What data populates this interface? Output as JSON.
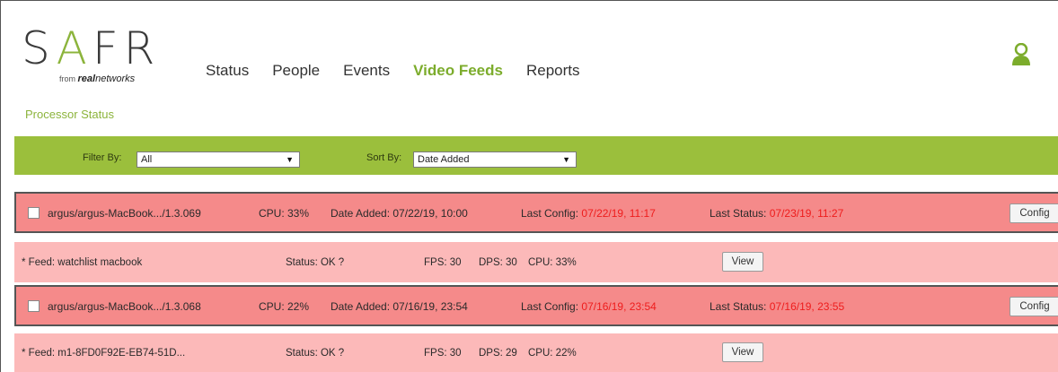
{
  "logo": {
    "part1": "S",
    "part2": "A",
    "part3": "FR",
    "from": "from",
    "brand_bold": "real",
    "brand_rest": "networks"
  },
  "nav": {
    "status": "Status",
    "people": "People",
    "events": "Events",
    "video_feeds": "Video Feeds",
    "reports": "Reports"
  },
  "subtitle": "Processor Status",
  "filter": {
    "filter_label": "Filter By:",
    "filter_value": "All",
    "sort_label": "Sort By:",
    "sort_value": "Date Added",
    "arrow": "▼"
  },
  "processors": [
    {
      "name": "argus/argus-MacBook.../1.3.069",
      "cpu": "CPU:  33%",
      "date_added": "Date Added: 07/22/19, 10:00",
      "last_config_label": "Last Config:",
      "last_config": "07/22/19, 11:17",
      "last_status_label": "Last Status:",
      "last_status": "07/23/19, 11:27",
      "config_btn": "Config",
      "feed": {
        "name": "* Feed: watchlist macbook",
        "status": "Status: OK ?",
        "fps": "FPS: 30",
        "dps": "DPS: 30",
        "cpu": "CPU: 33%",
        "view_btn": "View"
      }
    },
    {
      "name": "argus/argus-MacBook.../1.3.068",
      "cpu": "CPU:  22%",
      "date_added": "Date Added: 07/16/19, 23:54",
      "last_config_label": "Last Config:",
      "last_config": "07/16/19, 23:54",
      "last_status_label": "Last Status:",
      "last_status": "07/16/19, 23:55",
      "config_btn": "Config",
      "feed": {
        "name": "* Feed: m1-8FD0F92E-EB74-51D...",
        "status": "Status: OK ?",
        "fps": "FPS: 30",
        "dps": "DPS: 29",
        "cpu": "CPU: 22%",
        "view_btn": "View"
      }
    }
  ],
  "colors": {
    "accent_green": "#8cb43c",
    "filter_bar": "#9bbf3c",
    "processor_row": "#f58a8a",
    "feed_row": "#fcb9b9",
    "alert_red": "#ee1c1c"
  },
  "icons": {
    "user": "user-icon",
    "dropdown": "chevron-down-icon"
  }
}
